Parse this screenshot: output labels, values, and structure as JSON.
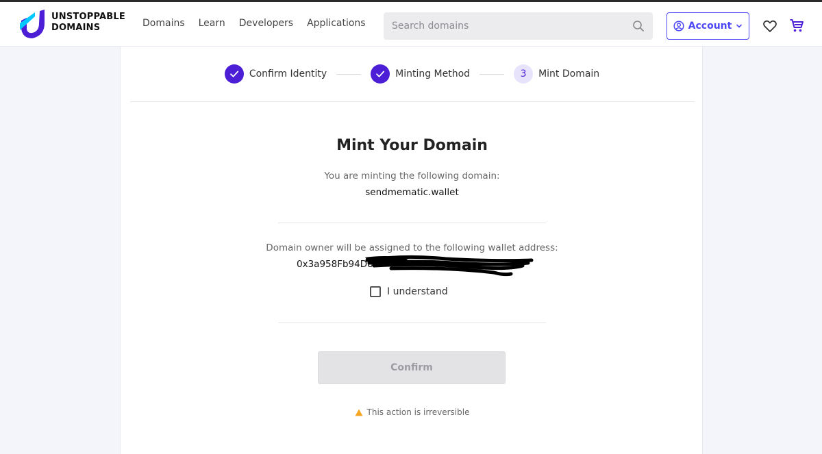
{
  "header": {
    "brand_line1": "UNSTOPPABLE",
    "brand_line2": "DOMAINS",
    "nav": [
      "Domains",
      "Learn",
      "Developers",
      "Applications"
    ],
    "search_placeholder": "Search domains",
    "account_label": "Account",
    "colors": {
      "accent": "#4c47f7",
      "logo_primary": "#4c1fd6",
      "logo_secondary": "#00c9ff"
    }
  },
  "steps": [
    {
      "label": "Confirm Identity",
      "status": "complete"
    },
    {
      "label": "Minting Method",
      "status": "complete"
    },
    {
      "label": "Mint Domain",
      "status": "current",
      "number": "3"
    }
  ],
  "main": {
    "title": "Mint Your Domain",
    "subtitle": "You are minting the following domain:",
    "domain": "sendmematic.wallet",
    "owner_text": "Domain owner will be assigned to the following wallet address:",
    "wallet_prefix": "0x3a958Fb94D8",
    "understand_label": "I understand",
    "confirm_label": "Confirm",
    "warning_text": "This action is irreversible"
  }
}
